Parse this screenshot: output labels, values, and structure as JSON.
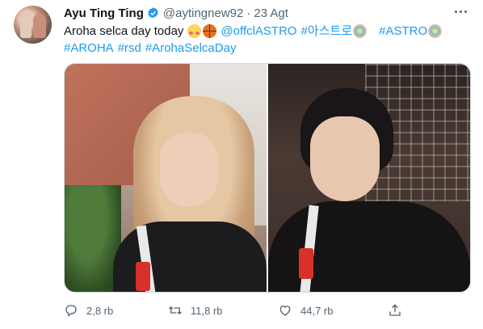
{
  "tweet": {
    "author": {
      "display_name": "Ayu Ting Ting",
      "handle": "@aytingnew92",
      "separator": "·",
      "date": "23 Agt",
      "verified": true
    },
    "text": {
      "line1_start": "Aroha selca day today",
      "line1_mention": "@offclASTRO",
      "line1_hashtag_korean": "#아스트로",
      "line1_hashtag_astro": "#ASTRO",
      "line2_hashtag_aroha": "#AROHA",
      "line2_hashtag_rsd": "#rsd",
      "line2_hashtag_arohaselcaday": "#ArohaSelcaDay"
    },
    "emojis": [
      "smiling-face-with-hearts-icon",
      "basketball-icon",
      "flower-icon"
    ],
    "actions": {
      "reply_count": "2,8 rb",
      "retweet_count": "11,8 rb",
      "like_count": "44,7 rb"
    },
    "colors": {
      "link": "#1d9bf0",
      "secondary": "#536471",
      "primary_text": "#0f1419",
      "verified": "#1d9bf0"
    }
  }
}
